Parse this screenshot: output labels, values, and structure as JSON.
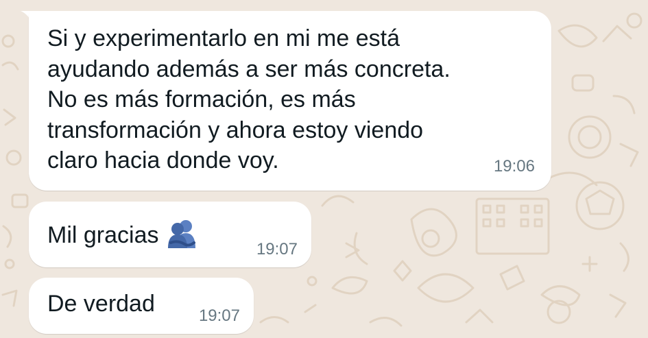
{
  "messages": [
    {
      "lines": [
        "Si y experimentarlo en mi me está",
        "ayudando además a ser más concreta.",
        "No es más formación, es más",
        "transformación y ahora estoy viendo",
        "claro hacia donde voy."
      ],
      "time": "19:06"
    },
    {
      "text": "Mil gracias",
      "emoji": "people-hugging-icon",
      "time": "19:07"
    },
    {
      "text": "De verdad",
      "time": "19:07"
    }
  ],
  "colors": {
    "background": "#efe7de",
    "doodle": "#e3d6c6",
    "bubble": "#ffffff",
    "text": "#111b21",
    "timestamp": "#667781",
    "emoji": "#4e73b8"
  }
}
